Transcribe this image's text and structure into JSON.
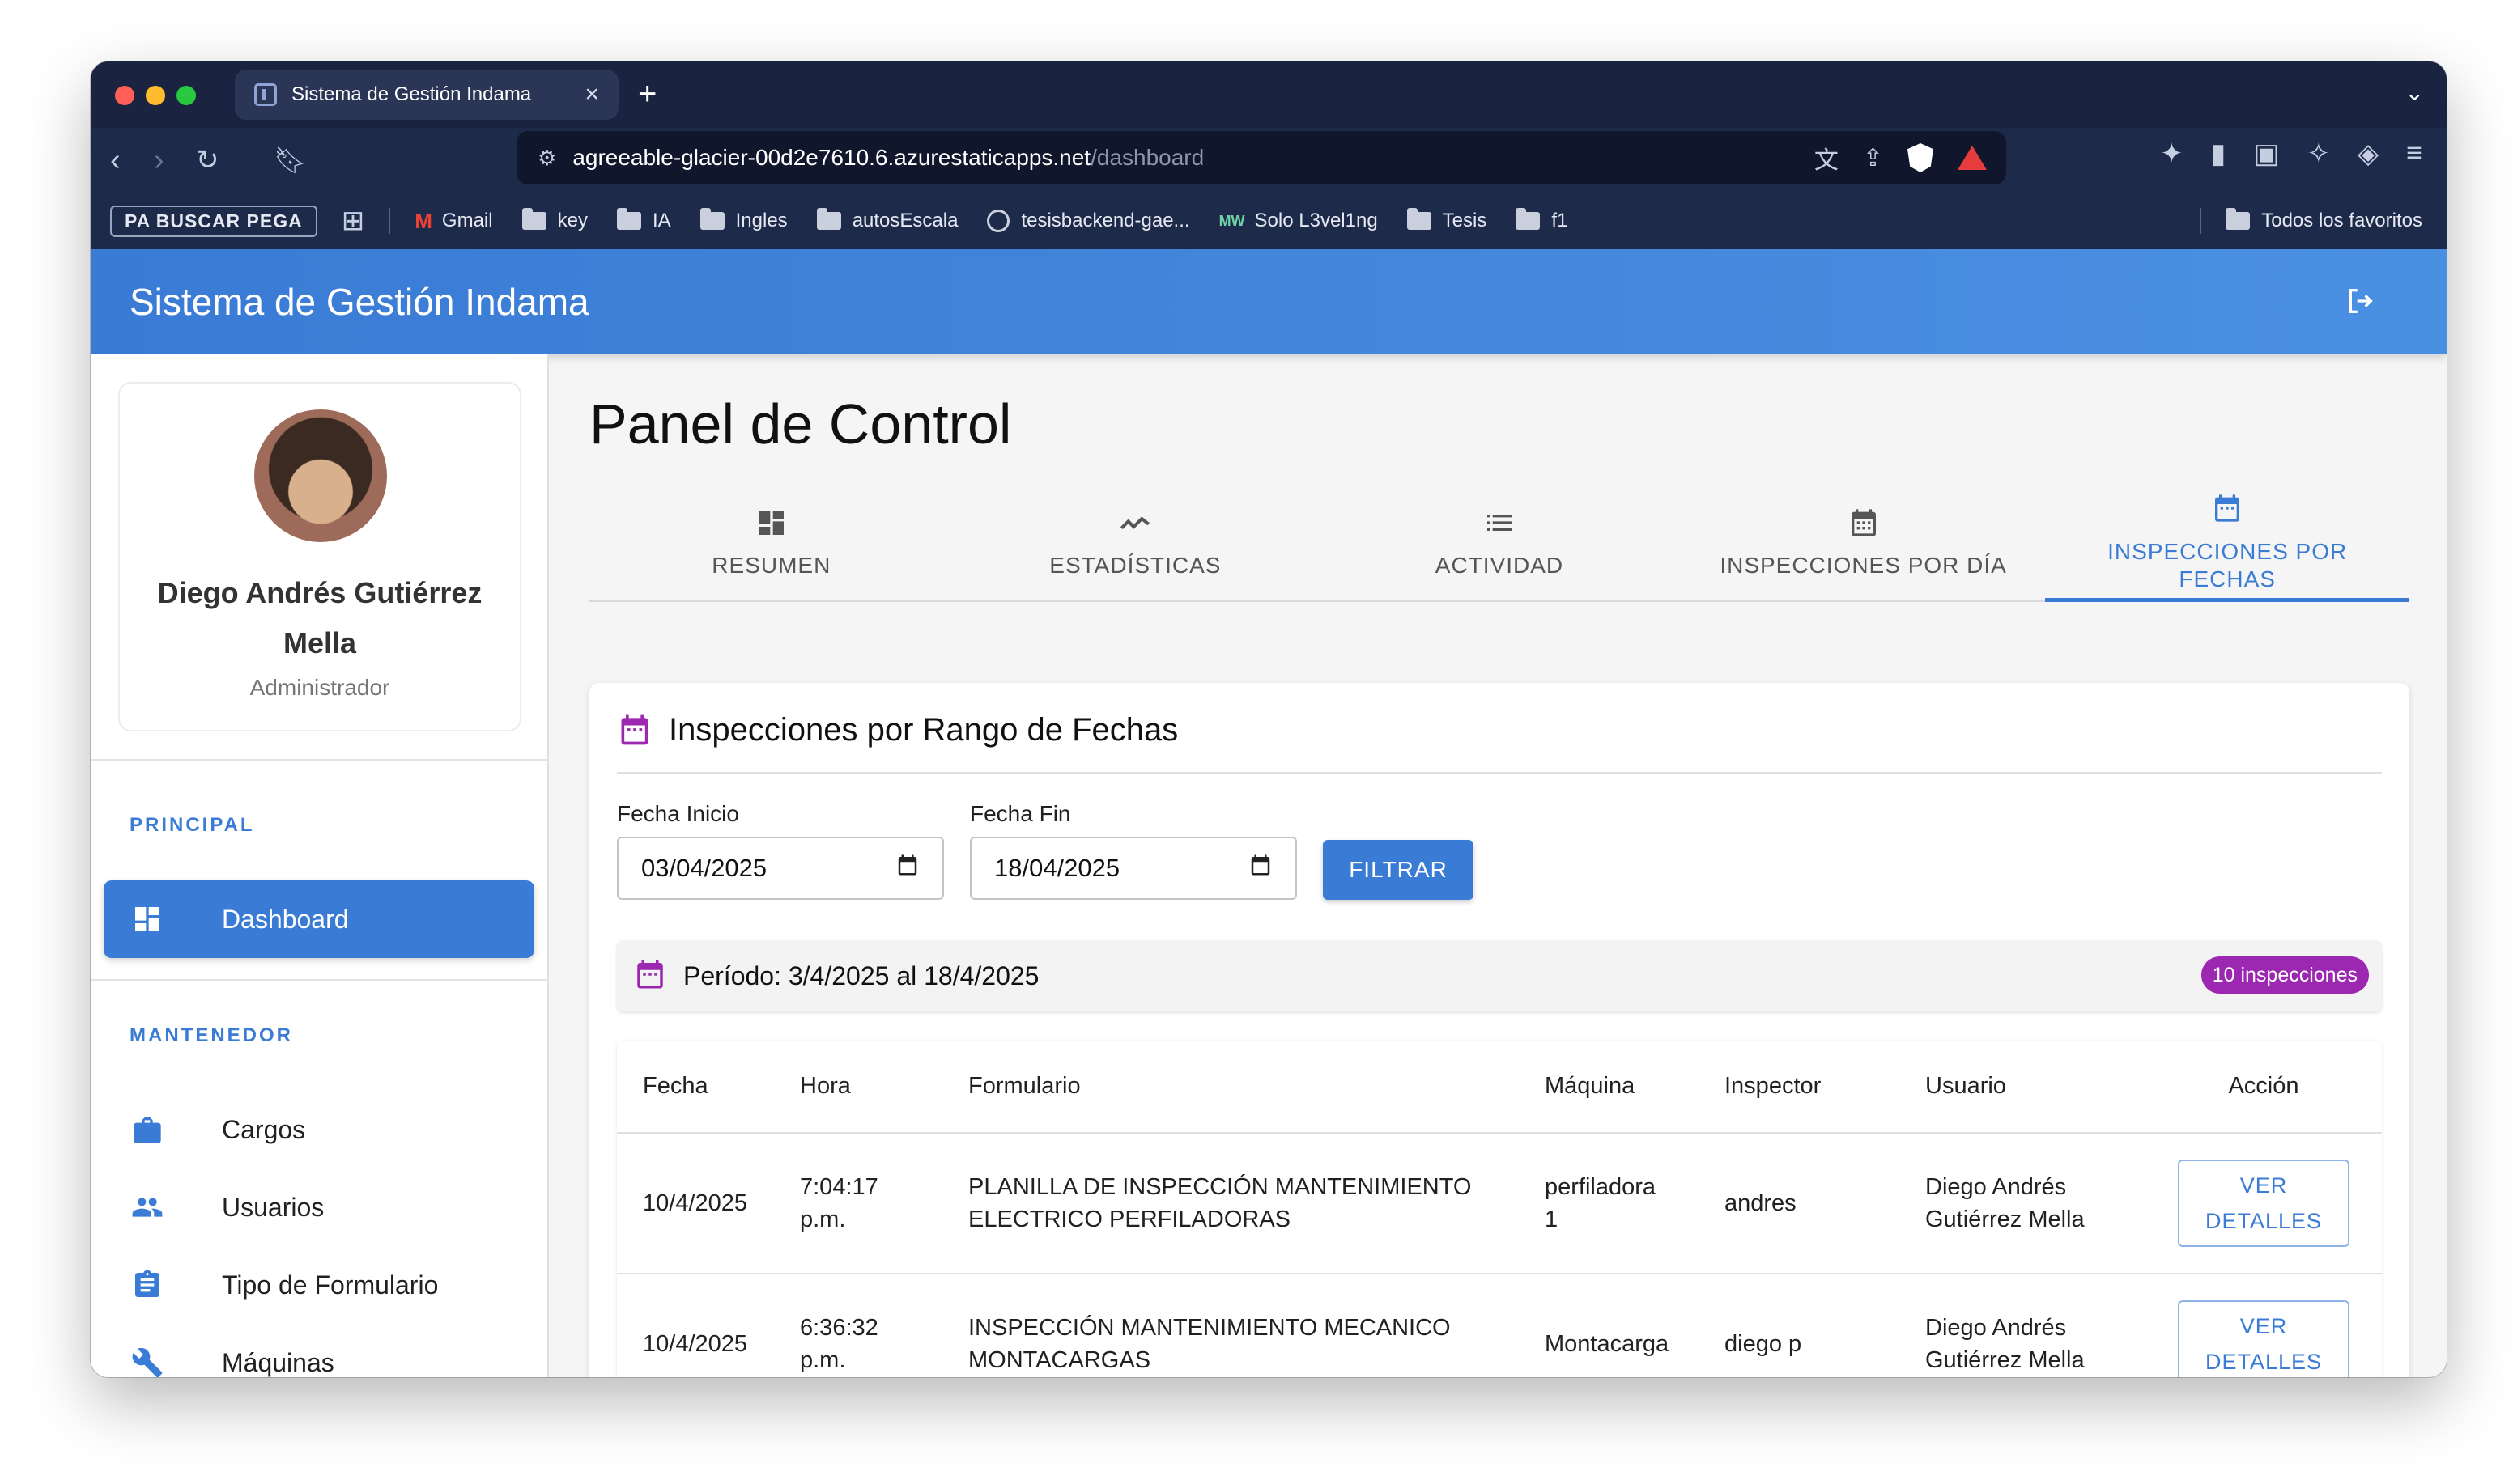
{
  "browser": {
    "tab_title": "Sistema de Gestión Indama",
    "tab_close": "×",
    "new_tab": "+",
    "url_host": "agreeable-glacier-00d2e7610.6.azurestaticapps.net",
    "url_path": "/dashboard",
    "bookmarks": {
      "pill": "PA BUSCAR PEGA",
      "items": [
        "Gmail",
        "key",
        "IA",
        "Ingles",
        "autosEscala",
        "tesisbackend-gae...",
        "Solo L3vel1ng",
        "Tesis",
        "f1"
      ],
      "all_favorites": "Todos los favoritos"
    },
    "colors": {
      "traffic_red": "#ff5f57",
      "traffic_yellow": "#febc2e",
      "traffic_green": "#28c840"
    }
  },
  "app": {
    "title": "Sistema de Gestión Indama",
    "logout_icon": "logout-icon",
    "accent": "#3a7bd5"
  },
  "sidebar": {
    "profile": {
      "name": "Diego Andrés Gutiérrez Mella",
      "role": "Administrador"
    },
    "sections": [
      {
        "label": "PRINCIPAL"
      },
      {
        "label": "MANTENEDOR"
      }
    ],
    "items": [
      {
        "label": "Dashboard",
        "icon": "dashboard-icon"
      },
      {
        "label": "Cargos",
        "icon": "briefcase-icon"
      },
      {
        "label": "Usuarios",
        "icon": "people-icon"
      },
      {
        "label": "Tipo de Formulario",
        "icon": "clipboard-icon"
      },
      {
        "label": "Máquinas",
        "icon": "wrench-icon"
      }
    ]
  },
  "main": {
    "page_title": "Panel de Control",
    "tabs": [
      {
        "label": "RESUMEN",
        "icon": "dashboard-icon"
      },
      {
        "label": "ESTADÍSTICAS",
        "icon": "trending-icon"
      },
      {
        "label": "ACTIVIDAD",
        "icon": "list-icon"
      },
      {
        "label": "INSPECCIONES POR DÍA",
        "icon": "calendar-icon"
      },
      {
        "label": "INSPECCIONES POR FECHAS",
        "icon": "calendar-icon"
      }
    ],
    "card": {
      "title": "Inspecciones por Rango de Fechas",
      "start_label": "Fecha Inicio",
      "start_value": "03/04/2025",
      "end_label": "Fecha Fin",
      "end_value": "18/04/2025",
      "filter_button": "FILTRAR",
      "period_text": "Período: 3/4/2025 al 18/4/2025",
      "count_badge": "10 inspecciones",
      "badge_color": "#9c27b0"
    },
    "table": {
      "headers": [
        "Fecha",
        "Hora",
        "Formulario",
        "Máquina",
        "Inspector",
        "Usuario",
        "Acción"
      ],
      "action_label_1": "VER",
      "action_label_2": "DETALLES",
      "rows": [
        {
          "fecha": "10/4/2025",
          "hora_1": "7:04:17",
          "hora_2": "p.m.",
          "formulario_1": "PLANILLA DE INSPECCIÓN MANTENIMIENTO",
          "formulario_2": "ELECTRICO PERFILADORAS",
          "maquina_1": "perfiladora",
          "maquina_2": "1",
          "inspector": "andres",
          "usuario_1": "Diego Andrés",
          "usuario_2": "Gutiérrez Mella"
        },
        {
          "fecha": "10/4/2025",
          "hora_1": "6:36:32",
          "hora_2": "p.m.",
          "formulario_1": "INSPECCIÓN MANTENIMIENTO MECANICO",
          "formulario_2": "MONTACARGAS",
          "maquina_1": "Montacarga",
          "maquina_2": "",
          "inspector": "diego p",
          "usuario_1": "Diego Andrés",
          "usuario_2": "Gutiérrez Mella"
        }
      ]
    }
  }
}
